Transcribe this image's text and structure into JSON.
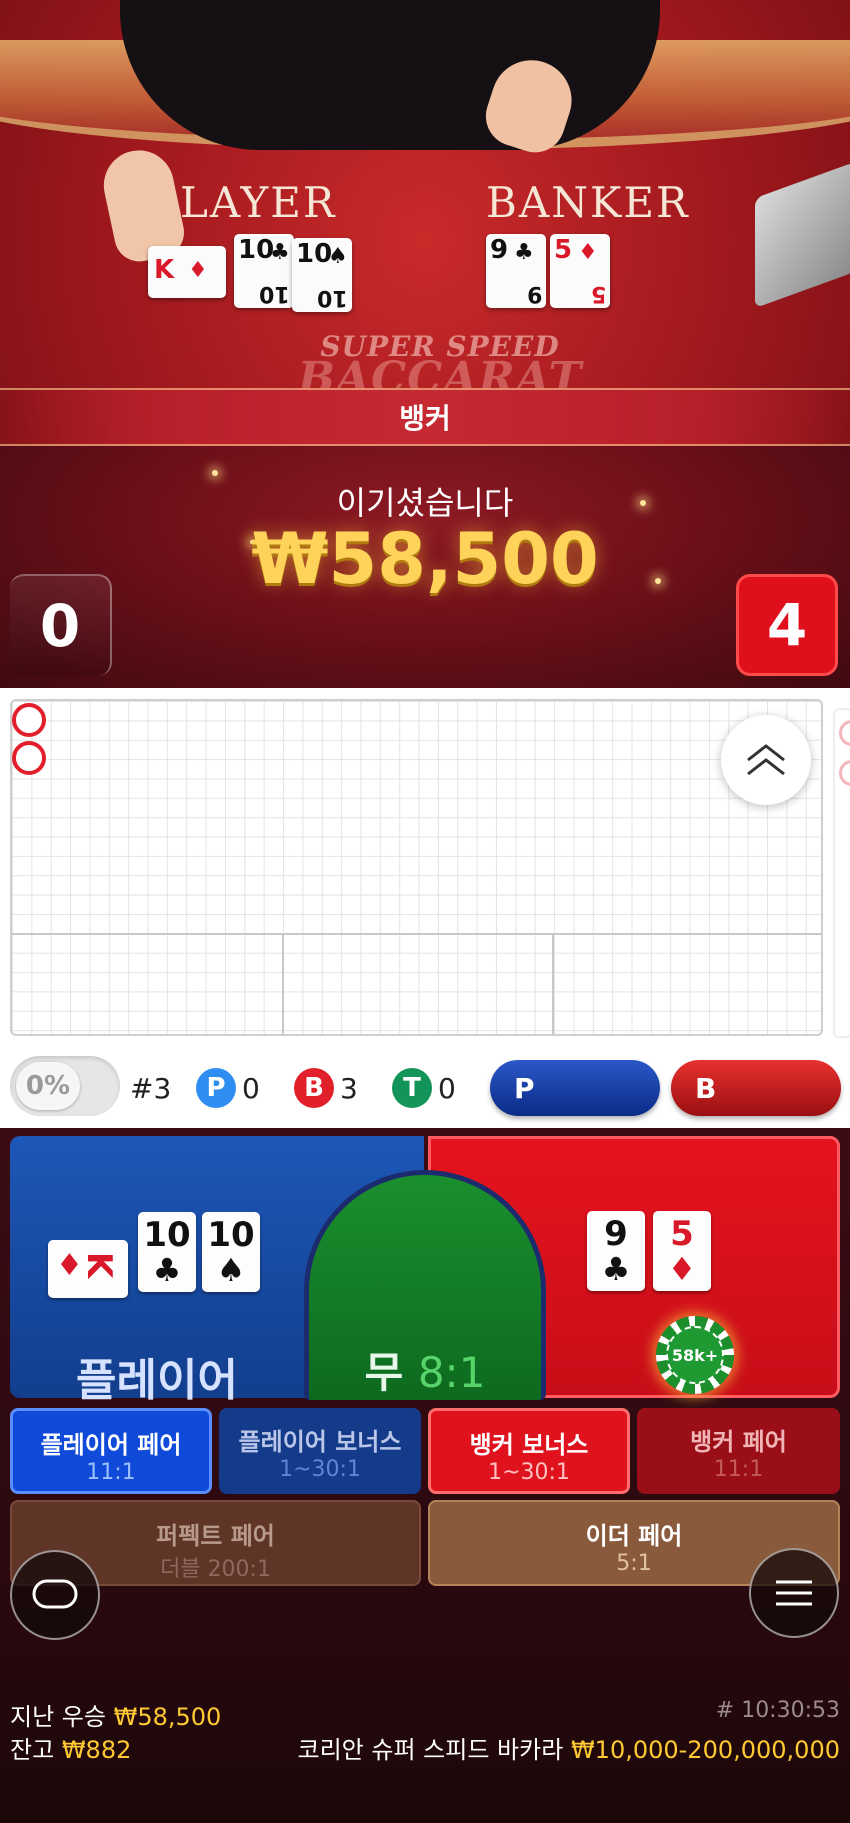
{
  "table": {
    "player_label": "LAYER",
    "banker_label": "BANKER",
    "logo_line1": "SUPER SPEED",
    "logo_line2": "BACCARAT",
    "result_text": "뱅커",
    "win_title": "이기셨습니다",
    "win_amount": "₩58,500",
    "player_score": "0",
    "banker_score": "4",
    "player_cards": [
      {
        "rank": "K",
        "suit": "♦",
        "color": "red"
      },
      {
        "rank": "10",
        "suit": "♣",
        "color": "black"
      },
      {
        "rank": "10",
        "suit": "♠",
        "color": "black"
      }
    ],
    "banker_cards": [
      {
        "rank": "9",
        "suit": "♣",
        "color": "black"
      },
      {
        "rank": "5",
        "suit": "♦",
        "color": "red"
      }
    ]
  },
  "stats": {
    "percent": "0%",
    "round": "#3",
    "player_letter": "P",
    "player_count": "0",
    "banker_letter": "B",
    "banker_count": "3",
    "tie_letter": "T",
    "tie_count": "0",
    "predict_player": "P",
    "predict_banker": "B"
  },
  "bets": {
    "player_label": "플레이어",
    "tie_label": "무",
    "tie_odds": "8:1",
    "chip_label": "58k+",
    "side_bets": [
      {
        "title": "플레이어 페어",
        "odds": "11:1"
      },
      {
        "title": "플레이어 보너스",
        "odds": "1~30:1"
      },
      {
        "title": "뱅커 보너스",
        "odds": "1~30:1"
      },
      {
        "title": "뱅커 페어",
        "odds": "11:1"
      },
      {
        "title": "퍼펙트 페어",
        "odds": "더블 200:1"
      },
      {
        "title": "이더 페어",
        "odds": "5:1"
      }
    ]
  },
  "footer": {
    "last_win_label": "지난 우승",
    "last_win_value": "₩58,500",
    "balance_label": "잔고",
    "balance_value": "₩882",
    "time": "# 10:30:53",
    "table_name": "코리안 슈퍼 스피드 바카라",
    "limits": "₩10,000-200,000,000"
  },
  "colors": {
    "player_blue": "#1d57b7",
    "banker_red": "#e5131e",
    "tie_green": "#1b8f2f",
    "gold": "#ffc933"
  }
}
